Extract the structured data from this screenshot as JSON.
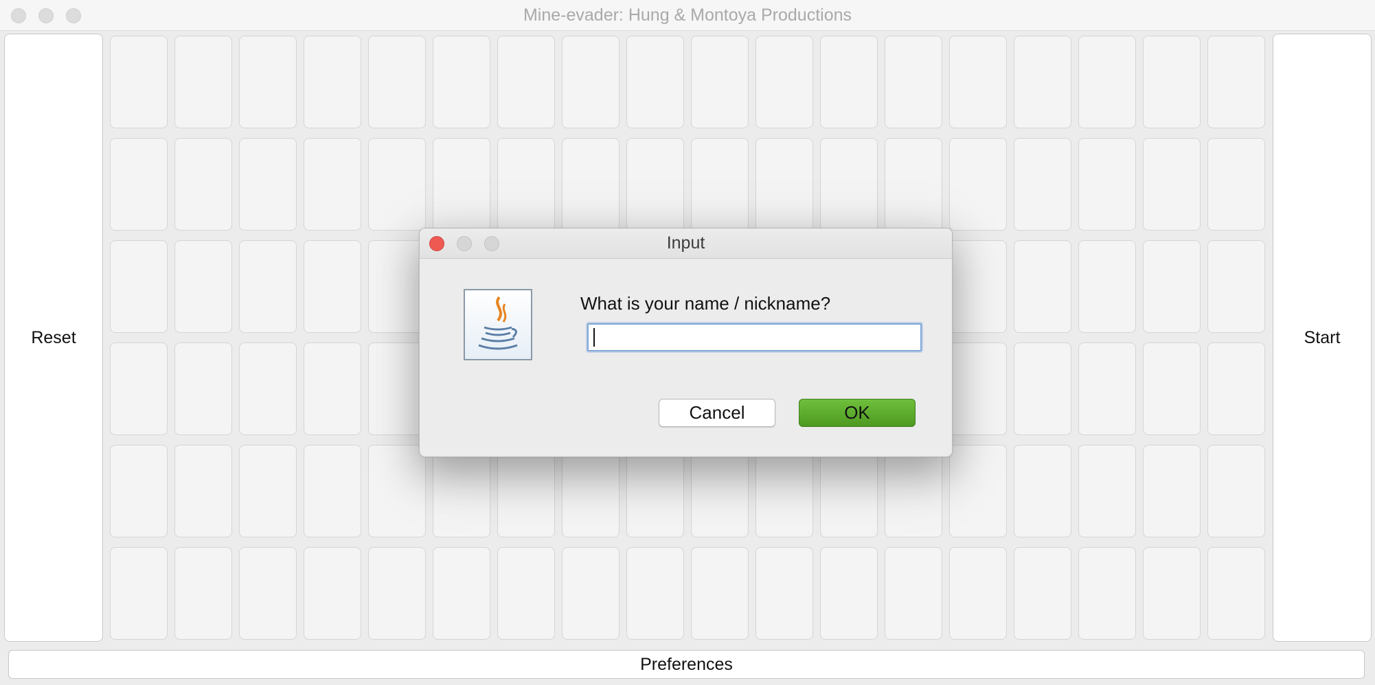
{
  "window": {
    "title": "Mine-evader: Hung & Montoya Productions",
    "close_icon": "close-icon",
    "minimize_icon": "minimize-icon",
    "zoom_icon": "zoom-icon"
  },
  "sidebar": {
    "reset_label": "Reset",
    "start_label": "Start"
  },
  "board": {
    "columns": 18,
    "rows": 6,
    "cell_state": "unrevealed"
  },
  "footer": {
    "preferences_label": "Preferences"
  },
  "dialog": {
    "title": "Input",
    "icon": "java-coffee-cup-icon",
    "prompt": "What is your name / nickname?",
    "input_value": "",
    "input_placeholder": "",
    "cancel_label": "Cancel",
    "ok_label": "OK",
    "colors": {
      "ok_button": "#5aa82e",
      "close_button": "#ee5a52",
      "input_focus": "#7fa7d8"
    }
  }
}
